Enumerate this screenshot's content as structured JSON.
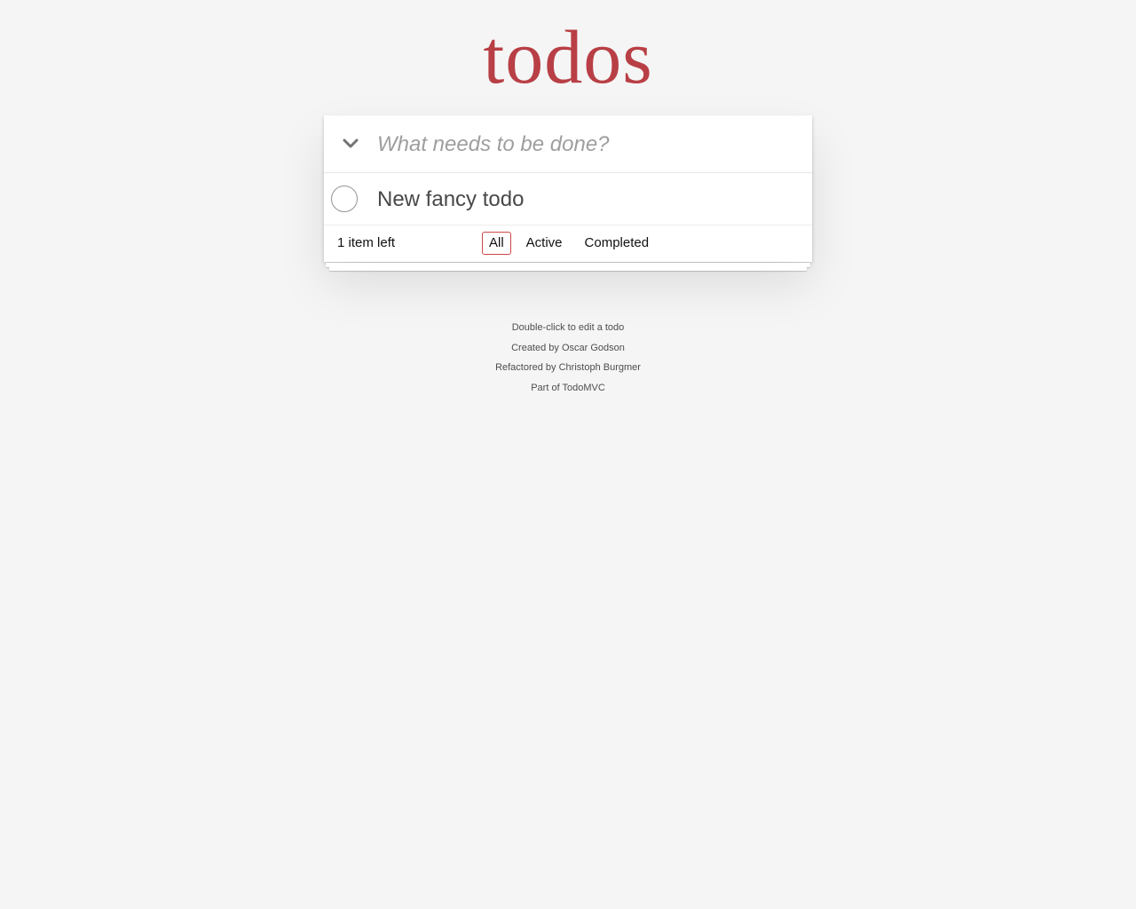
{
  "app": {
    "title": "todos"
  },
  "header": {
    "toggle_all_icon": "chevron-down-icon",
    "new_todo_placeholder": "What needs to be done?",
    "new_todo_value": ""
  },
  "todos": [
    {
      "label": "New fancy todo",
      "completed": false
    }
  ],
  "footer": {
    "count_text": "1 item left",
    "filters": [
      {
        "label": "All",
        "selected": true
      },
      {
        "label": "Active",
        "selected": false
      },
      {
        "label": "Completed",
        "selected": false
      }
    ]
  },
  "info": {
    "hint": "Double-click to edit a todo",
    "created_prefix": "Created by ",
    "created_name": "Oscar Godson",
    "refactored_prefix": "Refactored by ",
    "refactored_name": "Christoph Burgmer",
    "part_prefix": "Part of ",
    "part_name": "TodoMVC"
  },
  "colors": {
    "title": "#b83f45",
    "background": "#f5f5f5",
    "selected_filter_border": "#ce4646"
  }
}
